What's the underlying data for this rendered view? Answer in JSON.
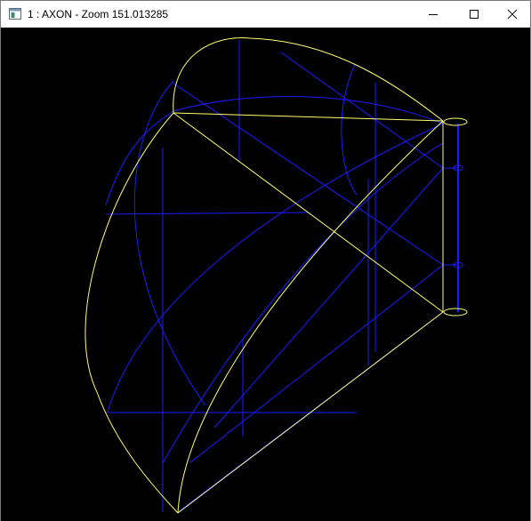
{
  "window": {
    "title": "1 : AXON - Zoom 151.013285",
    "icon": "app-window-icon"
  },
  "controls": {
    "minimize_icon": "minimize-icon",
    "maximize_icon": "maximize-icon",
    "close_icon": "close-icon"
  },
  "viewport": {
    "background": "#000000",
    "yellow_stroke": "#ffff66",
    "blue_stroke": "#2020ff"
  }
}
